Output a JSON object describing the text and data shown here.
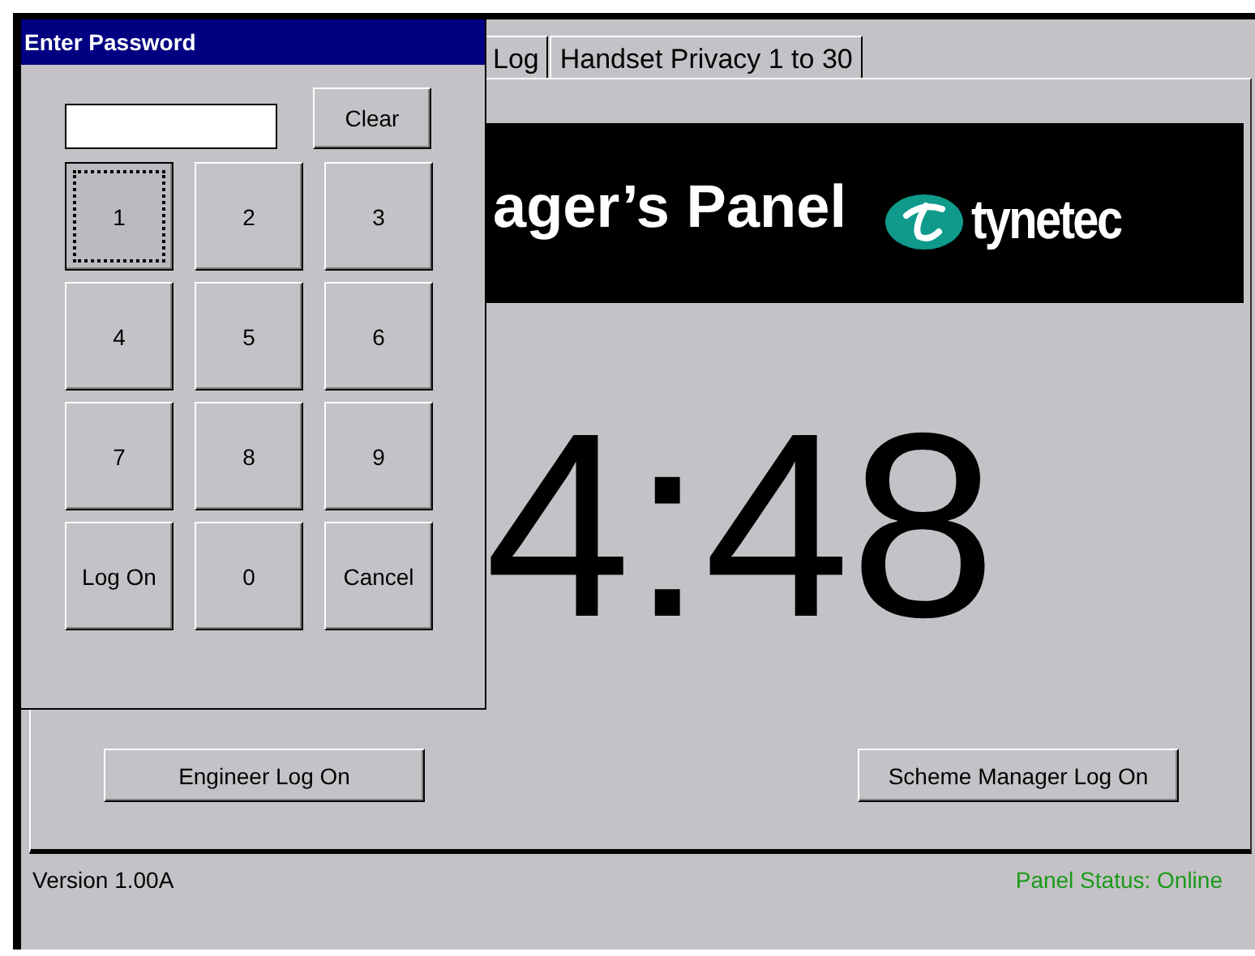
{
  "dialog": {
    "title": "Enter Password",
    "clear_button": "Clear",
    "keys": [
      {
        "label": "1",
        "focused": true
      },
      {
        "label": "2",
        "focused": false
      },
      {
        "label": "3",
        "focused": false
      },
      {
        "label": "4",
        "focused": false
      },
      {
        "label": "5",
        "focused": false
      },
      {
        "label": "6",
        "focused": false
      },
      {
        "label": "7",
        "focused": false
      },
      {
        "label": "8",
        "focused": false
      },
      {
        "label": "9",
        "focused": false
      },
      {
        "label": "Log On",
        "focused": false
      },
      {
        "label": "0",
        "focused": false
      },
      {
        "label": "Cancel",
        "focused": false
      }
    ]
  },
  "tabs": [
    {
      "label": "Log",
      "selected": false
    },
    {
      "label": "Handset Privacy 1 to 30",
      "selected": false
    }
  ],
  "banner": {
    "title": "ager’s Panel",
    "logo": "tynetec"
  },
  "clock": "4:48",
  "buttons": [
    "Engineer Log On",
    "Scheme Manager Log On"
  ],
  "status_bar": {
    "version": "Version 1.00A",
    "status": "Panel Status: Online"
  }
}
